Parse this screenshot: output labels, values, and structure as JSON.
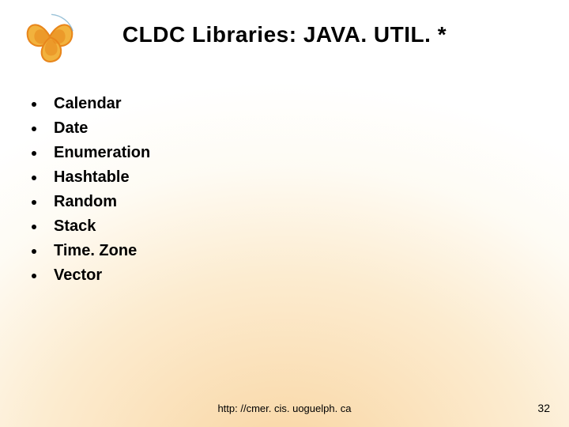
{
  "title": "CLDC Libraries: JAVA. UTIL. *",
  "bullets": [
    "Calendar",
    "Date",
    "Enumeration",
    "Hashtable",
    "Random",
    "Stack",
    "Time. Zone",
    "Vector"
  ],
  "footer_url": "http: //cmer. cis. uoguelph. ca",
  "page_number": "32",
  "colors": {
    "logo_orange": "#e8861c",
    "logo_gold": "#f2b23d",
    "logo_blue": "#6fa8c7"
  }
}
